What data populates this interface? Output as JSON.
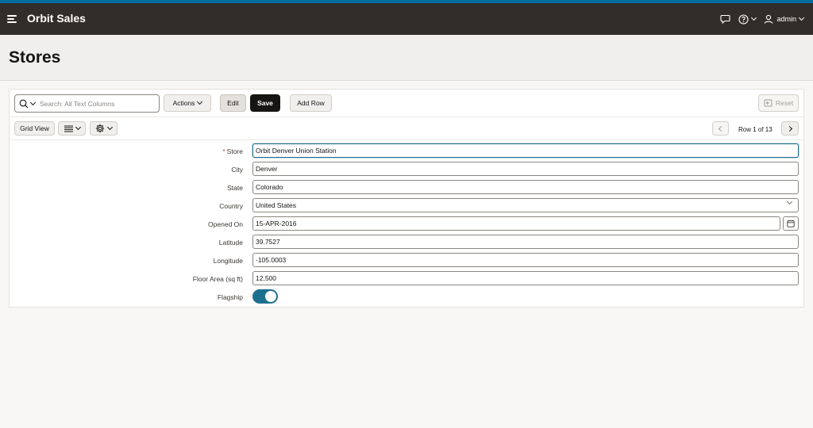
{
  "colors": {
    "accent": "#056ba0",
    "header_bg": "#312d2a",
    "primary_button": "#161513",
    "toggle_on": "#1d6f8e",
    "required": "#c74634"
  },
  "header": {
    "app_title": "Orbit Sales",
    "icons": [
      "menu-icon",
      "chat-icon",
      "help-icon",
      "user-icon"
    ],
    "user": "admin"
  },
  "page": {
    "title": "Stores"
  },
  "toolbar": {
    "search_placeholder": "Search: All Text Columns",
    "actions_label": "Actions",
    "edit_label": "Edit",
    "save_label": "Save",
    "add_row_label": "Add Row",
    "reset_label": "Reset"
  },
  "subbar": {
    "grid_view_label": "Grid View",
    "pager_text": "Row 1 of 13"
  },
  "form": {
    "fields": [
      {
        "label": "Store",
        "value": "Orbit Denver Union Station",
        "required": true
      },
      {
        "label": "City",
        "value": "Denver"
      },
      {
        "label": "State",
        "value": "Colorado"
      },
      {
        "label": "Country",
        "value": "United States",
        "type": "select"
      },
      {
        "label": "Opened On",
        "value": "15-APR-2016",
        "type": "date"
      },
      {
        "label": "Latitude",
        "value": "39.7527"
      },
      {
        "label": "Longitude",
        "value": "-105.0003"
      },
      {
        "label": "Floor Area (sq ft)",
        "value": "12,500"
      },
      {
        "label": "Flagship",
        "type": "toggle",
        "checked": true
      }
    ]
  }
}
